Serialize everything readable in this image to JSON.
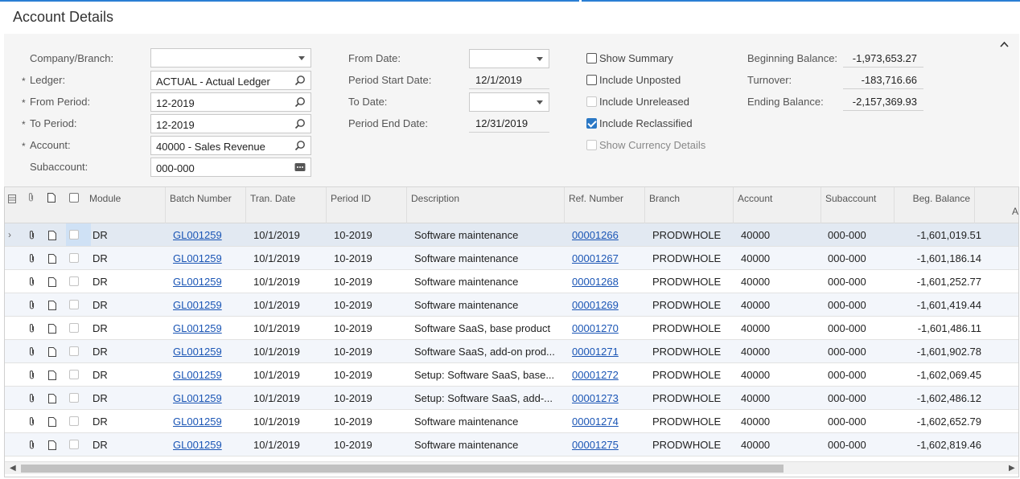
{
  "page": {
    "title": "Account Details"
  },
  "filters": {
    "company_branch": {
      "label": "Company/Branch:",
      "value": ""
    },
    "ledger": {
      "label": "Ledger:",
      "value": "ACTUAL - Actual Ledger"
    },
    "from_period": {
      "label": "From Period:",
      "value": "12-2019"
    },
    "to_period": {
      "label": "To Period:",
      "value": "12-2019"
    },
    "account": {
      "label": "Account:",
      "value": "40000 - Sales Revenue"
    },
    "subaccount": {
      "label": "Subaccount:",
      "value": "000-000"
    },
    "from_date": {
      "label": "From Date:",
      "value": ""
    },
    "period_start_date": {
      "label": "Period Start Date:",
      "value": "12/1/2019"
    },
    "to_date": {
      "label": "To Date:",
      "value": ""
    },
    "period_end_date": {
      "label": "Period End Date:",
      "value": "12/31/2019"
    },
    "required_marker": "*"
  },
  "options": {
    "show_summary": {
      "label": "Show Summary",
      "checked": false,
      "disabled": false
    },
    "include_unposted": {
      "label": "Include Unposted",
      "checked": false,
      "disabled": false
    },
    "include_unreleased": {
      "label": "Include Unreleased",
      "checked": false,
      "disabled": true
    },
    "include_reclassified": {
      "label": "Include Reclassified",
      "checked": true,
      "disabled": false
    },
    "show_currency_details": {
      "label": "Show Currency Details",
      "checked": false,
      "disabled": true
    }
  },
  "balances": {
    "beginning": {
      "label": "Beginning Balance:",
      "value": "-1,973,653.27"
    },
    "turnover": {
      "label": "Turnover:",
      "value": "-183,716.66"
    },
    "ending": {
      "label": "Ending Balance:",
      "value": "-2,157,369.93"
    }
  },
  "grid": {
    "columns": {
      "module": "Module",
      "batch_number": "Batch Number",
      "tran_date": "Tran. Date",
      "period_id": "Period ID",
      "description": "Description",
      "ref_number": "Ref. Number",
      "branch": "Branch",
      "account": "Account",
      "subaccount": "Subaccount",
      "beg_balance": "Beg. Balance",
      "overflow": "A"
    },
    "rows": [
      {
        "module": "DR",
        "batch": "GL001259",
        "date": "10/1/2019",
        "period": "10-2019",
        "desc": "Software maintenance",
        "ref": "00001266",
        "branch": "PRODWHOLE",
        "account": "40000",
        "sub": "000-000",
        "beg": "-1,601,019.51"
      },
      {
        "module": "DR",
        "batch": "GL001259",
        "date": "10/1/2019",
        "period": "10-2019",
        "desc": "Software maintenance",
        "ref": "00001267",
        "branch": "PRODWHOLE",
        "account": "40000",
        "sub": "000-000",
        "beg": "-1,601,186.14"
      },
      {
        "module": "DR",
        "batch": "GL001259",
        "date": "10/1/2019",
        "period": "10-2019",
        "desc": "Software maintenance",
        "ref": "00001268",
        "branch": "PRODWHOLE",
        "account": "40000",
        "sub": "000-000",
        "beg": "-1,601,252.77"
      },
      {
        "module": "DR",
        "batch": "GL001259",
        "date": "10/1/2019",
        "period": "10-2019",
        "desc": "Software maintenance",
        "ref": "00001269",
        "branch": "PRODWHOLE",
        "account": "40000",
        "sub": "000-000",
        "beg": "-1,601,419.44"
      },
      {
        "module": "DR",
        "batch": "GL001259",
        "date": "10/1/2019",
        "period": "10-2019",
        "desc": "Software SaaS, base product",
        "ref": "00001270",
        "branch": "PRODWHOLE",
        "account": "40000",
        "sub": "000-000",
        "beg": "-1,601,486.11"
      },
      {
        "module": "DR",
        "batch": "GL001259",
        "date": "10/1/2019",
        "period": "10-2019",
        "desc": "Software SaaS, add-on prod...",
        "ref": "00001271",
        "branch": "PRODWHOLE",
        "account": "40000",
        "sub": "000-000",
        "beg": "-1,601,902.78"
      },
      {
        "module": "DR",
        "batch": "GL001259",
        "date": "10/1/2019",
        "period": "10-2019",
        "desc": "Setup: Software SaaS, base...",
        "ref": "00001272",
        "branch": "PRODWHOLE",
        "account": "40000",
        "sub": "000-000",
        "beg": "-1,602,069.45"
      },
      {
        "module": "DR",
        "batch": "GL001259",
        "date": "10/1/2019",
        "period": "10-2019",
        "desc": "Setup: Software SaaS, add-...",
        "ref": "00001273",
        "branch": "PRODWHOLE",
        "account": "40000",
        "sub": "000-000",
        "beg": "-1,602,486.12"
      },
      {
        "module": "DR",
        "batch": "GL001259",
        "date": "10/1/2019",
        "period": "10-2019",
        "desc": "Software maintenance",
        "ref": "00001274",
        "branch": "PRODWHOLE",
        "account": "40000",
        "sub": "000-000",
        "beg": "-1,602,652.79"
      },
      {
        "module": "DR",
        "batch": "GL001259",
        "date": "10/1/2019",
        "period": "10-2019",
        "desc": "Software maintenance",
        "ref": "00001275",
        "branch": "PRODWHOLE",
        "account": "40000",
        "sub": "000-000",
        "beg": "-1,602,819.46"
      }
    ]
  },
  "colors": {
    "accent": "#2a7fd4",
    "link": "#1a55b5",
    "checked": "#2b78c5"
  }
}
